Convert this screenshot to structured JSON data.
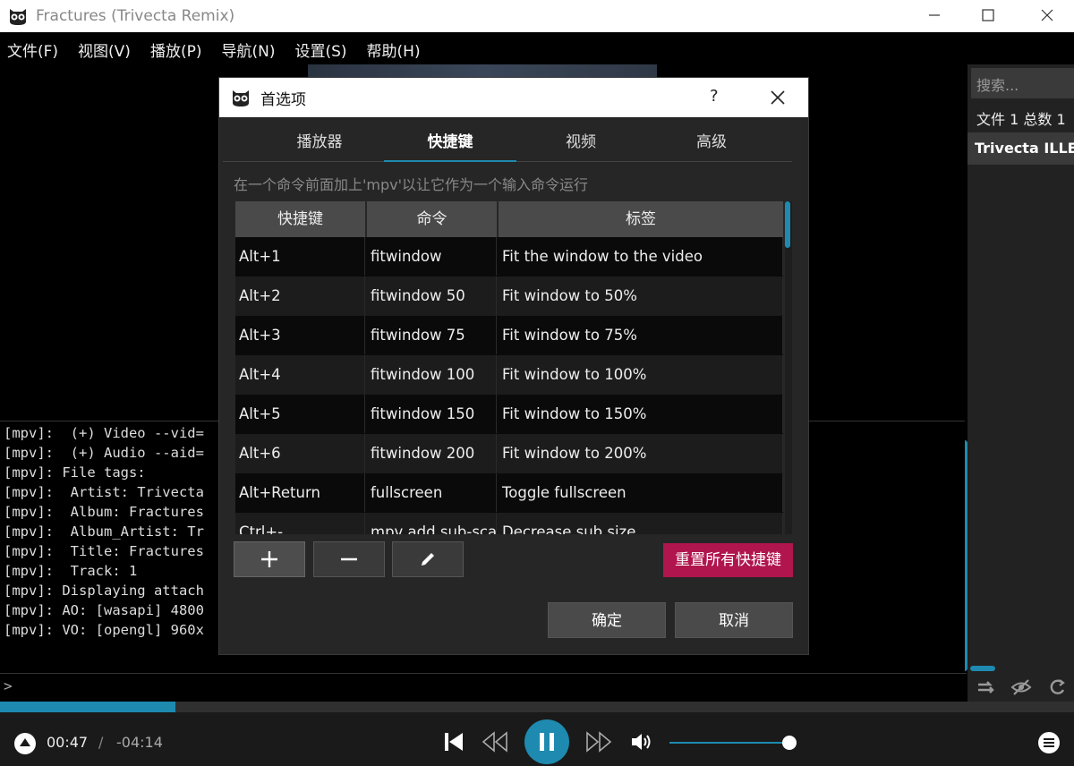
{
  "window": {
    "title": "Fractures (Trivecta Remix)"
  },
  "menu": [
    {
      "label": "文件(F)"
    },
    {
      "label": "视图(V)"
    },
    {
      "label": "播放(P)"
    },
    {
      "label": "导航(N)"
    },
    {
      "label": "设置(S)"
    },
    {
      "label": "帮助(H)"
    }
  ],
  "playlist": {
    "search_placeholder": "搜索...",
    "count": "文件 1 总数 1",
    "items": [
      {
        "label": "Trivecta ILLENIUM"
      }
    ]
  },
  "log": {
    "lines": [
      "[mpv]:  (+) Video --vid=",
      "[mpv]:  (+) Audio --aid=",
      "[mpv]: File tags:",
      "[mpv]:  Artist: Trivecta",
      "[mpv]:  Album: Fractures",
      "[mpv]:  Album_Artist: Tr",
      "[mpv]:  Title: Fractures",
      "[mpv]:  Track: 1",
      "[mpv]: Displaying attach",
      "[mpv]: AO: [wasapi] 4800",
      "[mpv]: VO: [opengl] 960x"
    ],
    "prompt": ">"
  },
  "player": {
    "time_elapsed": "00:47",
    "time_separator": "/",
    "time_remaining": "-04:14",
    "progress": 0.163,
    "volume": 1.0
  },
  "dialog": {
    "title": "首选项",
    "help": "?",
    "tabs": [
      {
        "label": "播放器",
        "active": false
      },
      {
        "label": "快捷键",
        "active": true
      },
      {
        "label": "视频",
        "active": false
      },
      {
        "label": "高级",
        "active": false
      }
    ],
    "hint": "在一个命令前面加上'mpv'以让它作为一个输入命令运行",
    "columns": [
      "快捷键",
      "命令",
      "标签"
    ],
    "rows": [
      {
        "key": "Alt+1",
        "command": "fitwindow",
        "label": "Fit the window to the video"
      },
      {
        "key": "Alt+2",
        "command": "fitwindow 50",
        "label": "Fit window to 50%"
      },
      {
        "key": "Alt+3",
        "command": "fitwindow 75",
        "label": "Fit window to 75%"
      },
      {
        "key": "Alt+4",
        "command": "fitwindow 100",
        "label": "Fit window to 100%"
      },
      {
        "key": "Alt+5",
        "command": "fitwindow 150",
        "label": "Fit window to 150%"
      },
      {
        "key": "Alt+6",
        "command": "fitwindow 200",
        "label": "Fit window to 200%"
      },
      {
        "key": "Alt+Return",
        "command": "fullscreen",
        "label": "Toggle fullscreen"
      },
      {
        "key": "Ctrl+-",
        "command": "mpv add sub-scale",
        "label": "Decrease sub size"
      }
    ],
    "reset_label": "重置所有快捷键",
    "ok_label": "确定",
    "cancel_label": "取消"
  },
  "colors": {
    "accent": "#1e8ab0",
    "reset": "#b0154e"
  }
}
